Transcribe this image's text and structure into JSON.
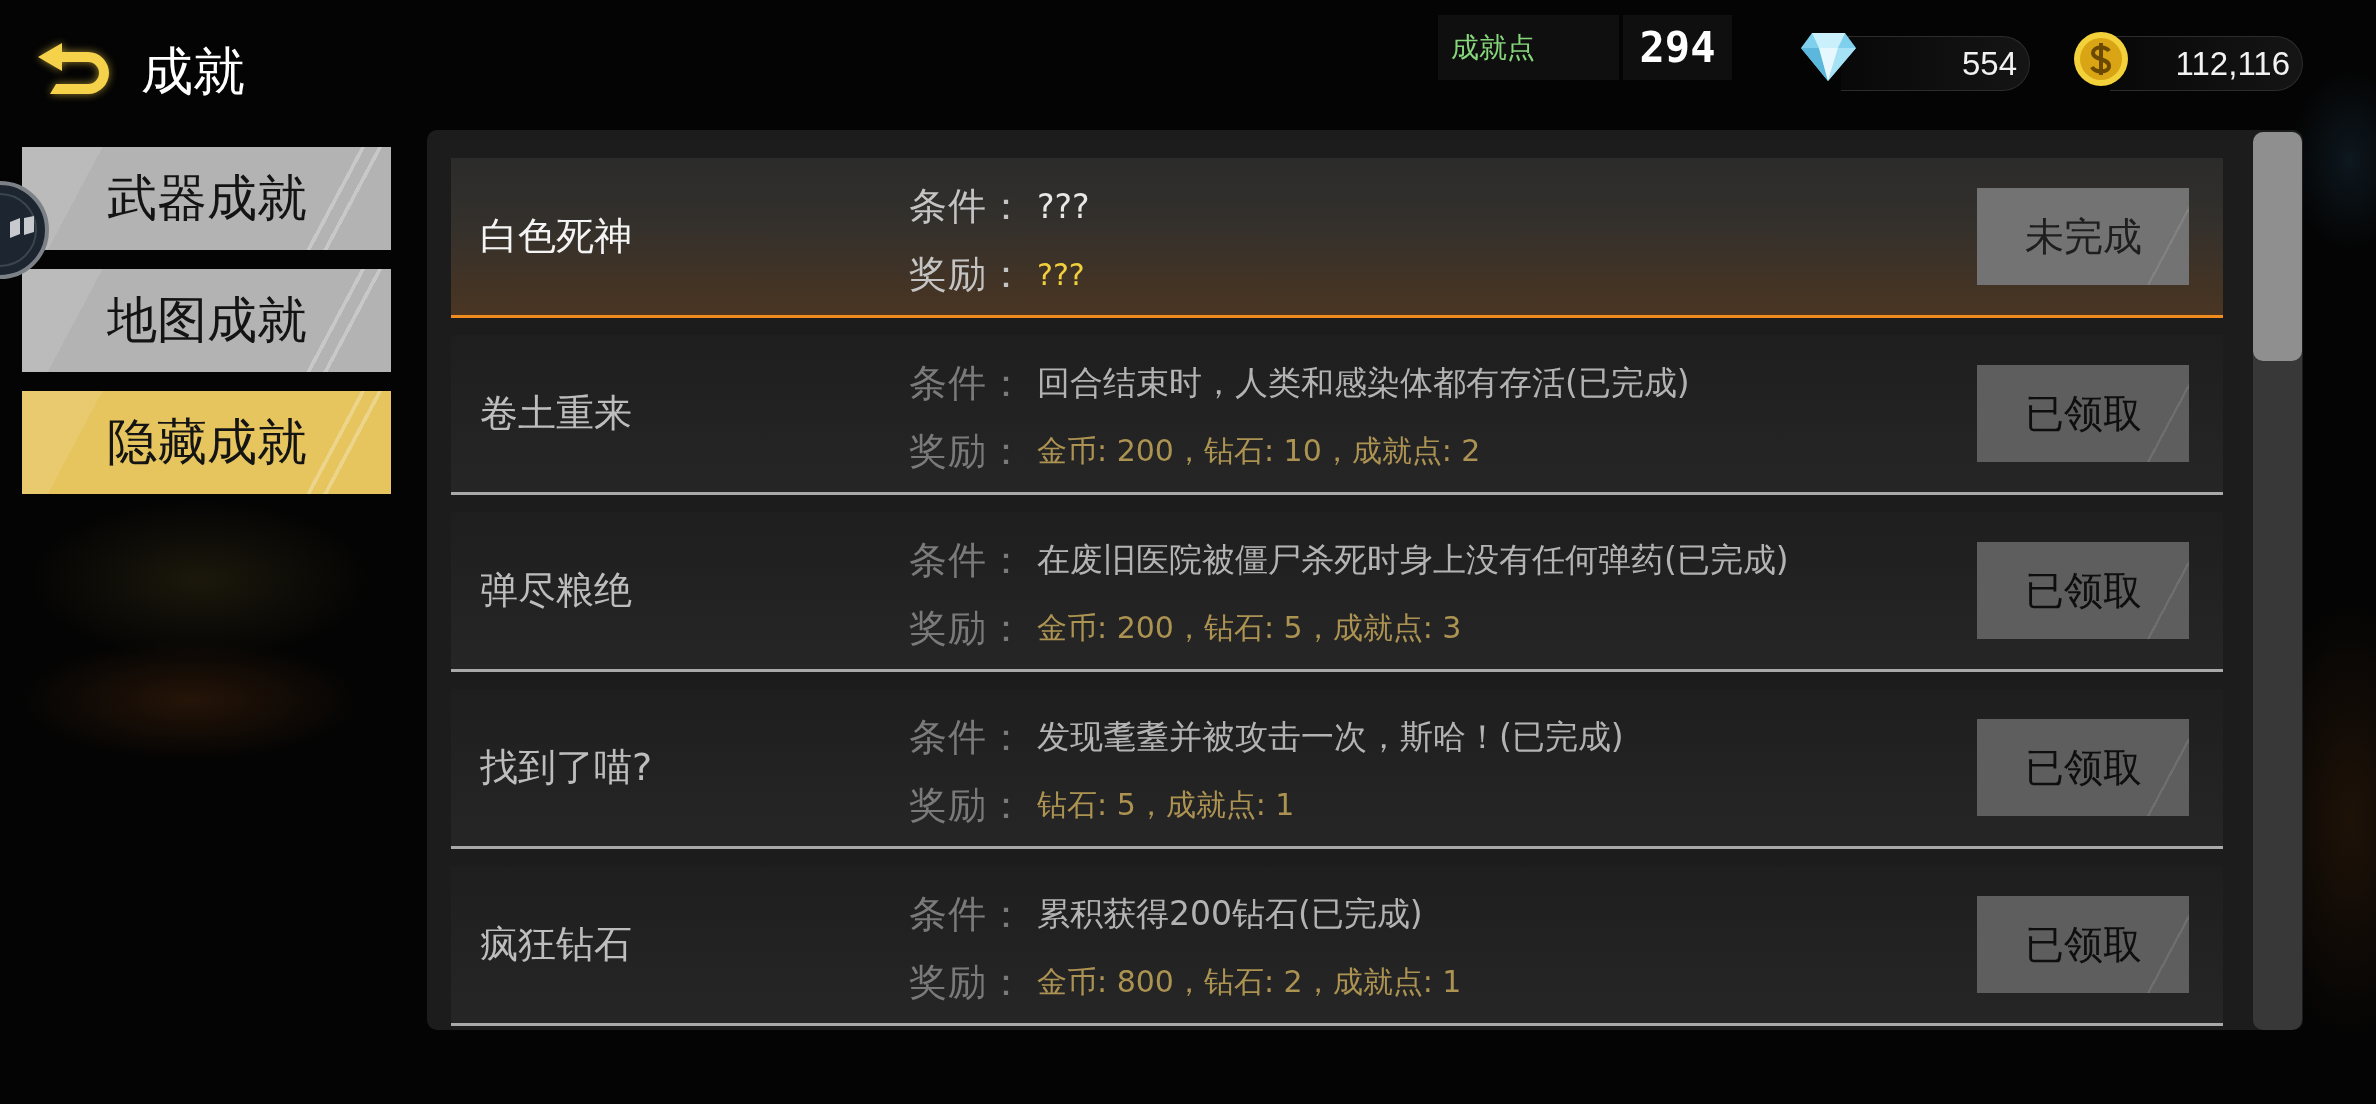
{
  "header": {
    "title": "成就"
  },
  "achievement_points": {
    "label": "成就点",
    "value": "294"
  },
  "diamonds": {
    "value": "554"
  },
  "coins": {
    "value": "112,116"
  },
  "categories": [
    {
      "label": "武器成就",
      "selected": false
    },
    {
      "label": "地图成就",
      "selected": false
    },
    {
      "label": "隐藏成就",
      "selected": true
    }
  ],
  "achievements": [
    {
      "name": "白色死神",
      "condition_label": "条件：",
      "condition": "???",
      "reward_label": "奖励：",
      "reward": "???",
      "button": "未完成",
      "selected": true
    },
    {
      "name": "卷土重来",
      "condition_label": "条件：",
      "condition": "回合结束时，人类和感染体都有存活(已完成)",
      "reward_label": "奖励：",
      "reward": "金币: 200，钻石: 10，成就点: 2",
      "button": "已领取",
      "selected": false
    },
    {
      "name": "弹尽粮绝",
      "condition_label": "条件：",
      "condition": "在废旧医院被僵尸杀死时身上没有任何弹药(已完成)",
      "reward_label": "奖励：",
      "reward": "金币: 200，钻石: 5，成就点: 3",
      "button": "已领取",
      "selected": false
    },
    {
      "name": "找到了喵?",
      "condition_label": "条件：",
      "condition": "发现耄耋并被攻击一次，斯哈！(已完成)",
      "reward_label": "奖励：",
      "reward": "钻石: 5，成就点: 1",
      "button": "已领取",
      "selected": false
    },
    {
      "name": "疯狂钻石",
      "condition_label": "条件：",
      "condition": "累积获得200钻石(已完成)",
      "reward_label": "奖励：",
      "reward": "金币: 800，钻石: 2，成就点: 1",
      "button": "已领取",
      "selected": false
    }
  ]
}
